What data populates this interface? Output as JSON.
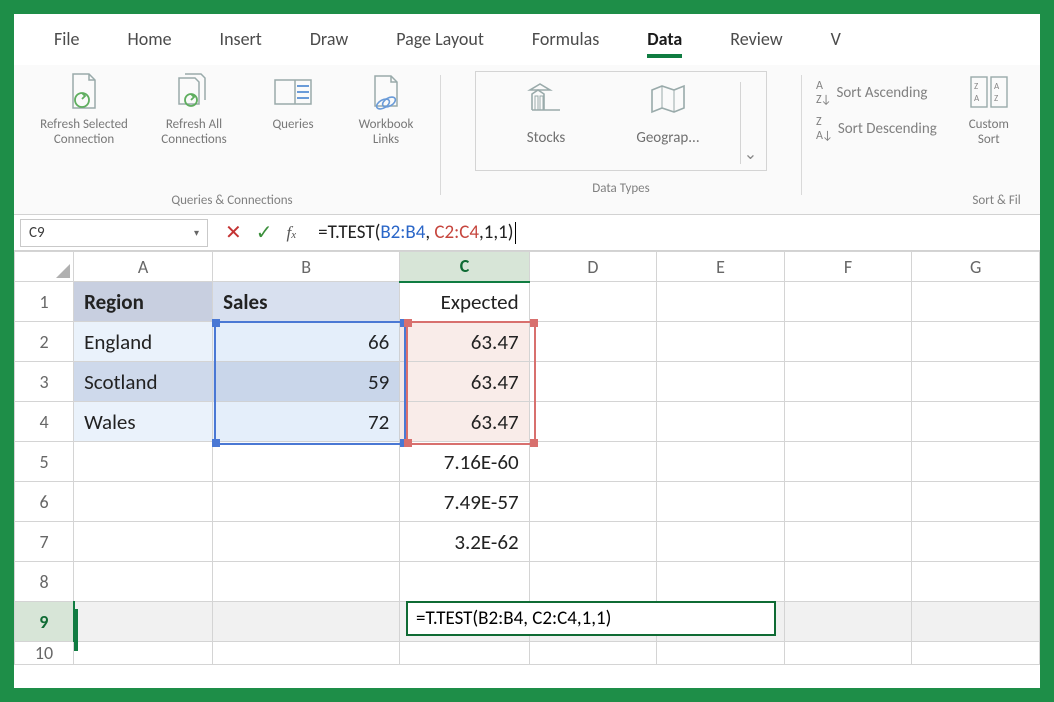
{
  "tabs": {
    "file": "File",
    "home": "Home",
    "insert": "Insert",
    "draw": "Draw",
    "pagelayout": "Page Layout",
    "formulas": "Formulas",
    "data": "Data",
    "review": "Review",
    "view": "V"
  },
  "ribbon": {
    "queries": {
      "refresh_sel": "Refresh Selected Connection",
      "refresh_all": "Refresh All Connections",
      "queries": "Queries",
      "workbook_links": "Workbook Links",
      "group": "Queries & Connections"
    },
    "datatypes": {
      "stocks": "Stocks",
      "geo": "Geograp...",
      "group": "Data Types"
    },
    "sort": {
      "asc": "Sort Ascending",
      "desc": "Sort Descending",
      "custom": "Custom Sort",
      "group": "Sort & Fil"
    }
  },
  "namebox": "C9",
  "formula": {
    "prefix": "=T.TEST(",
    "ref1": "B2:B4",
    "sep1": ", ",
    "ref2": "C2:C4",
    "suffix": ",1,1)"
  },
  "columns": [
    "A",
    "B",
    "C",
    "D",
    "E",
    "F",
    "G"
  ],
  "rows": [
    "1",
    "2",
    "3",
    "4",
    "5",
    "6",
    "7",
    "8",
    "9",
    "10"
  ],
  "cells": {
    "A1": "Region",
    "B1": "Sales",
    "C1": "Expected",
    "A2": "England",
    "B2": "66",
    "C2": "63.47",
    "A3": "Scotland",
    "B3": "59",
    "C3": "63.47",
    "A4": "Wales",
    "B4": "72",
    "C4": "63.47",
    "C5": "7.16E-60",
    "C6": "7.49E-57",
    "C7": "3.2E-62"
  },
  "overlay_formula": "=T.TEST(B2:B4, C2:C4,1,1)",
  "chart_data": {
    "type": "table",
    "title": "",
    "columns": [
      "Region",
      "Sales",
      "Expected"
    ],
    "rows": [
      [
        "England",
        66,
        63.47
      ],
      [
        "Scotland",
        59,
        63.47
      ],
      [
        "Wales",
        72,
        63.47
      ]
    ],
    "extra_values": {
      "C5": 7.16e-60,
      "C6": 7.49e-57,
      "C7": 3.2e-62
    },
    "formula_cell": {
      "ref": "C9",
      "formula": "=T.TEST(B2:B4, C2:C4,1,1)"
    }
  }
}
